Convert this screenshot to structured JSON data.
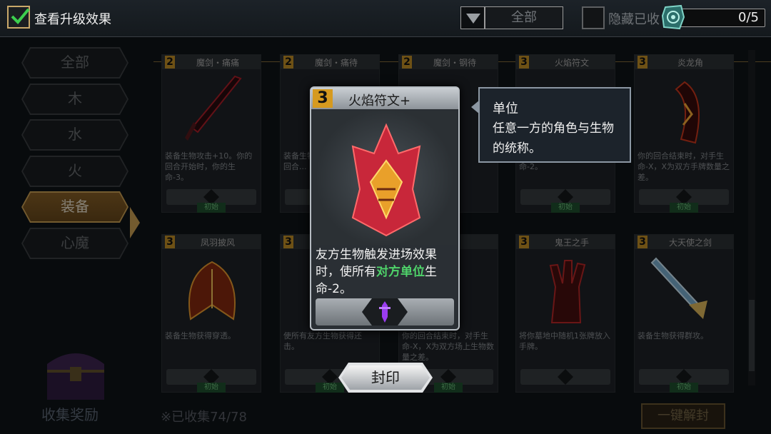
{
  "topbar": {
    "show_upgrade_label": "查看升级效果",
    "show_upgrade_checked": true,
    "filter_value": "全部",
    "hide_collected_label": "隐藏已收",
    "progress": "0/5"
  },
  "sidebar": {
    "items": [
      {
        "label": "全部",
        "active": false
      },
      {
        "label": "木",
        "active": false
      },
      {
        "label": "水",
        "active": false
      },
      {
        "label": "火",
        "active": false
      },
      {
        "label": "装备",
        "active": true
      },
      {
        "label": "心魔",
        "active": false
      }
    ],
    "collect_reward_label": "收集奖励"
  },
  "cards": [
    {
      "level": "2",
      "name": "魔剑・痛痛",
      "desc": "装备生物攻击+10。你的回合开始时，你的生命-3。",
      "tag": "初始"
    },
    {
      "level": "2",
      "name": "魔剑・痛待",
      "desc": "装备生物攻击+10。你的回合...",
      "tag": ""
    },
    {
      "level": "2",
      "name": "魔剑・钢待",
      "desc": "",
      "tag": ""
    },
    {
      "level": "3",
      "name": "火焰符文",
      "desc": "时，使所有对方生物生命-2。",
      "tag": "初始"
    },
    {
      "level": "3",
      "name": "炎龙角",
      "desc": "你的回合结束时，对手生命-X，X为双方手牌数量之差。",
      "tag": "初始"
    },
    {
      "level": "3",
      "name": "凤羽披风",
      "desc": "装备生物获得穿透。",
      "tag": "初始"
    },
    {
      "level": "3",
      "name": "",
      "desc": "使所有友方生物获得还击。",
      "tag": "初始"
    },
    {
      "level": "",
      "name": "",
      "desc": "你的回合结束时，对手生命-X，X为双方场上生物数量之差。",
      "tag": "初始"
    },
    {
      "level": "3",
      "name": "鬼王之手",
      "desc": "将你墓地中随机1张牌放入手牌。",
      "tag": ""
    },
    {
      "level": "3",
      "name": "大天使之剑",
      "desc": "装备生物获得群攻。",
      "tag": "初始"
    }
  ],
  "collected_text": "※已收集74/78",
  "unlock_all_label": "一键解封",
  "popup": {
    "level": "3",
    "name": "火焰符文+",
    "desc_part1": "友方生物触发进场效果时，使所有",
    "desc_highlight1": "对方",
    "desc_highlight2": "单位",
    "desc_part2": "生命-2。"
  },
  "seal_button_label": "封印",
  "tooltip": {
    "title": "单位",
    "body": "任意一方的角色与生物的统称。"
  },
  "colors": {
    "accent_gold": "#d2a657",
    "highlight_green": "#4fd36a",
    "level_badge": "#d69a1f"
  }
}
